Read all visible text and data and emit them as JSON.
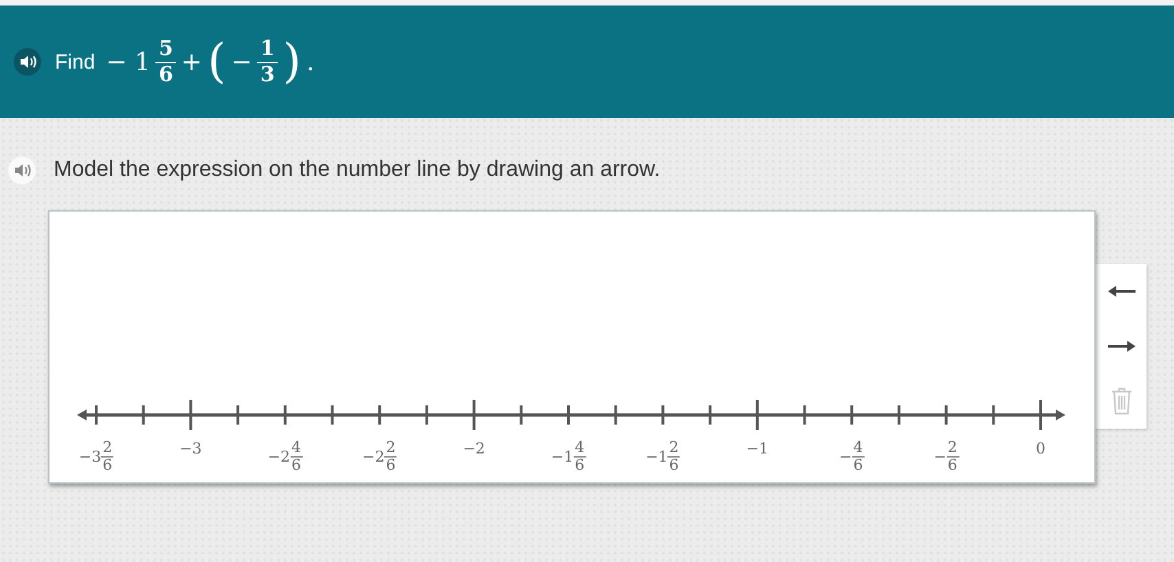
{
  "banner": {
    "label": "Find",
    "expression": [
      {
        "kind": "text",
        "text": "− 1"
      },
      {
        "kind": "frac",
        "num": "5",
        "den": "6"
      },
      {
        "kind": "text",
        "text": "+"
      },
      {
        "kind": "paren",
        "text": "("
      },
      {
        "kind": "text",
        "text": "−"
      },
      {
        "kind": "frac",
        "num": "1",
        "den": "3"
      },
      {
        "kind": "paren",
        "text": ")"
      },
      {
        "kind": "text",
        "text": "."
      }
    ]
  },
  "instruction": "Model the expression on the number line by drawing an arrow.",
  "number_line": {
    "ticks": [
      {
        "major": false,
        "label": {
          "whole": "−3",
          "num": "2",
          "den": "6"
        }
      },
      {
        "major": false
      },
      {
        "major": true,
        "label": {
          "whole": "−3"
        }
      },
      {
        "major": false
      },
      {
        "major": false,
        "label": {
          "whole": "−2",
          "num": "4",
          "den": "6"
        }
      },
      {
        "major": false
      },
      {
        "major": false,
        "label": {
          "whole": "−2",
          "num": "2",
          "den": "6"
        }
      },
      {
        "major": false
      },
      {
        "major": true,
        "label": {
          "whole": "−2"
        }
      },
      {
        "major": false
      },
      {
        "major": false,
        "label": {
          "whole": "−1",
          "num": "4",
          "den": "6"
        }
      },
      {
        "major": false
      },
      {
        "major": false,
        "label": {
          "whole": "−1",
          "num": "2",
          "den": "6"
        }
      },
      {
        "major": false
      },
      {
        "major": true,
        "label": {
          "whole": "−1"
        }
      },
      {
        "major": false
      },
      {
        "major": false,
        "label": {
          "whole": "−",
          "num": "4",
          "den": "6"
        }
      },
      {
        "major": false
      },
      {
        "major": false,
        "label": {
          "whole": "−",
          "num": "2",
          "den": "6"
        }
      },
      {
        "major": false
      },
      {
        "major": true,
        "label": {
          "whole": "0"
        }
      }
    ]
  },
  "tools": [
    {
      "kind": "arrow-left",
      "disabled": false
    },
    {
      "kind": "arrow-right",
      "disabled": false
    },
    {
      "kind": "delete",
      "disabled": true
    }
  ]
}
